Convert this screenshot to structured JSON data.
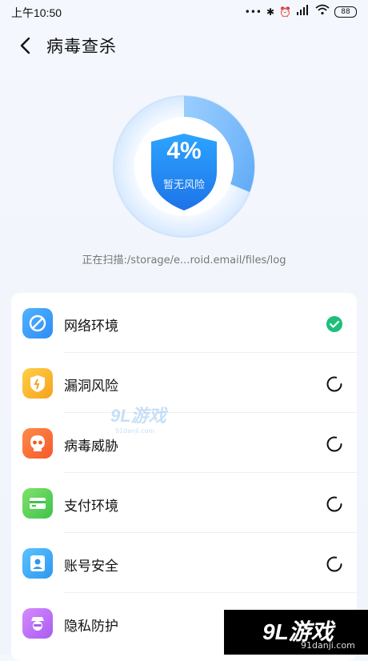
{
  "status_bar": {
    "time": "上午10:50",
    "dots": "•••",
    "bt": "✱",
    "alarm": "⏰",
    "hd": "HD",
    "signal": "4G",
    "wifi": "wifi",
    "battery": "88"
  },
  "header": {
    "title": "病毒查杀"
  },
  "scan": {
    "percent": "4%",
    "risk_status": "暂无风险",
    "progress": 0.04,
    "path": "正在扫描:/storage/e...roid.email/files/log"
  },
  "items": [
    {
      "label": "网络环境",
      "icon": "network-icon",
      "color_from": "#4fb3ff",
      "color_to": "#2f8cf5",
      "status": "done"
    },
    {
      "label": "漏洞风险",
      "icon": "vulnerability-shield-icon",
      "color_from": "#ffcf4a",
      "color_to": "#f7a21b",
      "status": "loading"
    },
    {
      "label": "病毒威胁",
      "icon": "skull-icon",
      "color_from": "#ff8a4a",
      "color_to": "#f45a2a",
      "status": "loading"
    },
    {
      "label": "支付环境",
      "icon": "payment-card-icon",
      "color_from": "#7ee36b",
      "color_to": "#3fc24a",
      "status": "loading"
    },
    {
      "label": "账号安全",
      "icon": "account-icon",
      "color_from": "#5ac3ff",
      "color_to": "#2e97f0",
      "status": "loading"
    },
    {
      "label": "隐私防护",
      "icon": "privacy-spy-icon",
      "color_from": "#d58bff",
      "color_to": "#a85cf0",
      "status": "loading"
    }
  ],
  "watermark": {
    "logo": "9L游戏",
    "url": "91danji.com"
  },
  "brand_corner": {
    "logo": "9L游戏",
    "url": "91danji.com"
  },
  "colors": {
    "accent": "#2f8cf5",
    "done": "#1dbf7a"
  }
}
